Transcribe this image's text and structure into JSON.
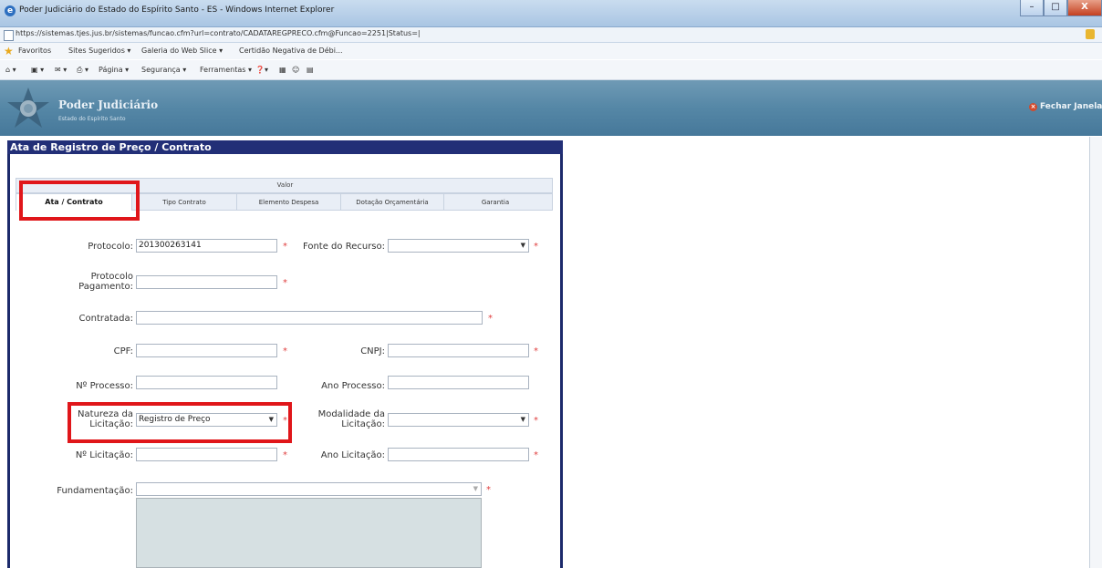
{
  "window": {
    "title": "Poder Judiciário do Estado do Espírito Santo - ES - Windows Internet Explorer",
    "url": "https://sistemas.tjes.jus.br/sistemas/funcao.cfm?url=contrato/CADATAREGPRECO.cfm@Funcao=2251|Status=|",
    "min": "–",
    "max": "□",
    "close": "X"
  },
  "favorites": {
    "label": "Favoritos",
    "items": [
      "Sites Sugeridos ▾",
      "Galeria do Web Slice ▾",
      "Certidão Negativa de Débi..."
    ]
  },
  "commandbar": {
    "items": [
      "Página ▾",
      "Segurança ▾",
      "Ferramentas ▾"
    ]
  },
  "app": {
    "title": "Poder Judiciário",
    "subtitle": "Estado do Espírito Santo",
    "close_label": "Fechar Janela"
  },
  "form": {
    "header": "Ata de Registro de Preço / Contrato",
    "tab_group_label": "Valor",
    "tabs": [
      "Ata / Contrato",
      "Tipo Contrato",
      "Elemento Despesa",
      "Dotação Orçamentária",
      "Garantia"
    ],
    "active_tab": "Ata / Contrato",
    "fields": {
      "protocolo": {
        "label": "Protocolo:",
        "value": "201300263141"
      },
      "fonte_recurso": {
        "label": "Fonte do Recurso:",
        "value": ""
      },
      "protocolo_pagamento": {
        "label1": "Protocolo",
        "label2": "Pagamento:",
        "value": ""
      },
      "contratada": {
        "label": "Contratada:",
        "value": ""
      },
      "cpf": {
        "label": "CPF:",
        "value": ""
      },
      "cnpj": {
        "label": "CNPJ:",
        "value": ""
      },
      "nro_processo": {
        "label": "Nº Processo:",
        "value": ""
      },
      "ano_processo": {
        "label": "Ano Processo:",
        "value": ""
      },
      "natureza_licitacao": {
        "label1": "Natureza da",
        "label2": "Licitação:",
        "value": "Registro de Preço"
      },
      "modalidade_licitacao": {
        "label1": "Modalidade da",
        "label2": "Licitação:",
        "value": ""
      },
      "nro_licitacao": {
        "label": "Nº Licitação:",
        "value": ""
      },
      "ano_licitacao": {
        "label": "Ano Licitação:",
        "value": ""
      },
      "fundamentacao": {
        "label": "Fundamentação:",
        "value": ""
      }
    },
    "required_mark": "*"
  },
  "colors": {
    "header_bg": "#5587a6",
    "panel_header": "#222f77",
    "highlight": "#e0161a",
    "required": "#e04040"
  }
}
